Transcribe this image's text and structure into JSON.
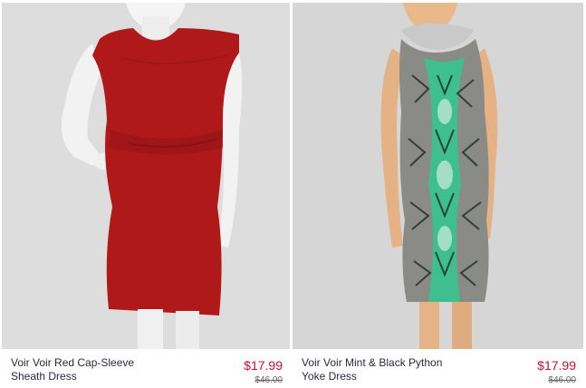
{
  "products": [
    {
      "name_line1": "Voir Voir Red Cap-Sleeve",
      "name_line2": "Sheath Dress",
      "price": "$17.99",
      "original_price": "$46.00",
      "dress_color": "#b0191a"
    },
    {
      "name_line1": "Voir Voir Mint & Black Python",
      "name_line2": "Yoke Dress",
      "price": "$17.99",
      "original_price": "$46.00",
      "dress_color": "#3fbf8f"
    }
  ],
  "colors": {
    "price": "#c8102e",
    "name": "#2a2a3c",
    "photo_bg": "#dcdcdc"
  }
}
